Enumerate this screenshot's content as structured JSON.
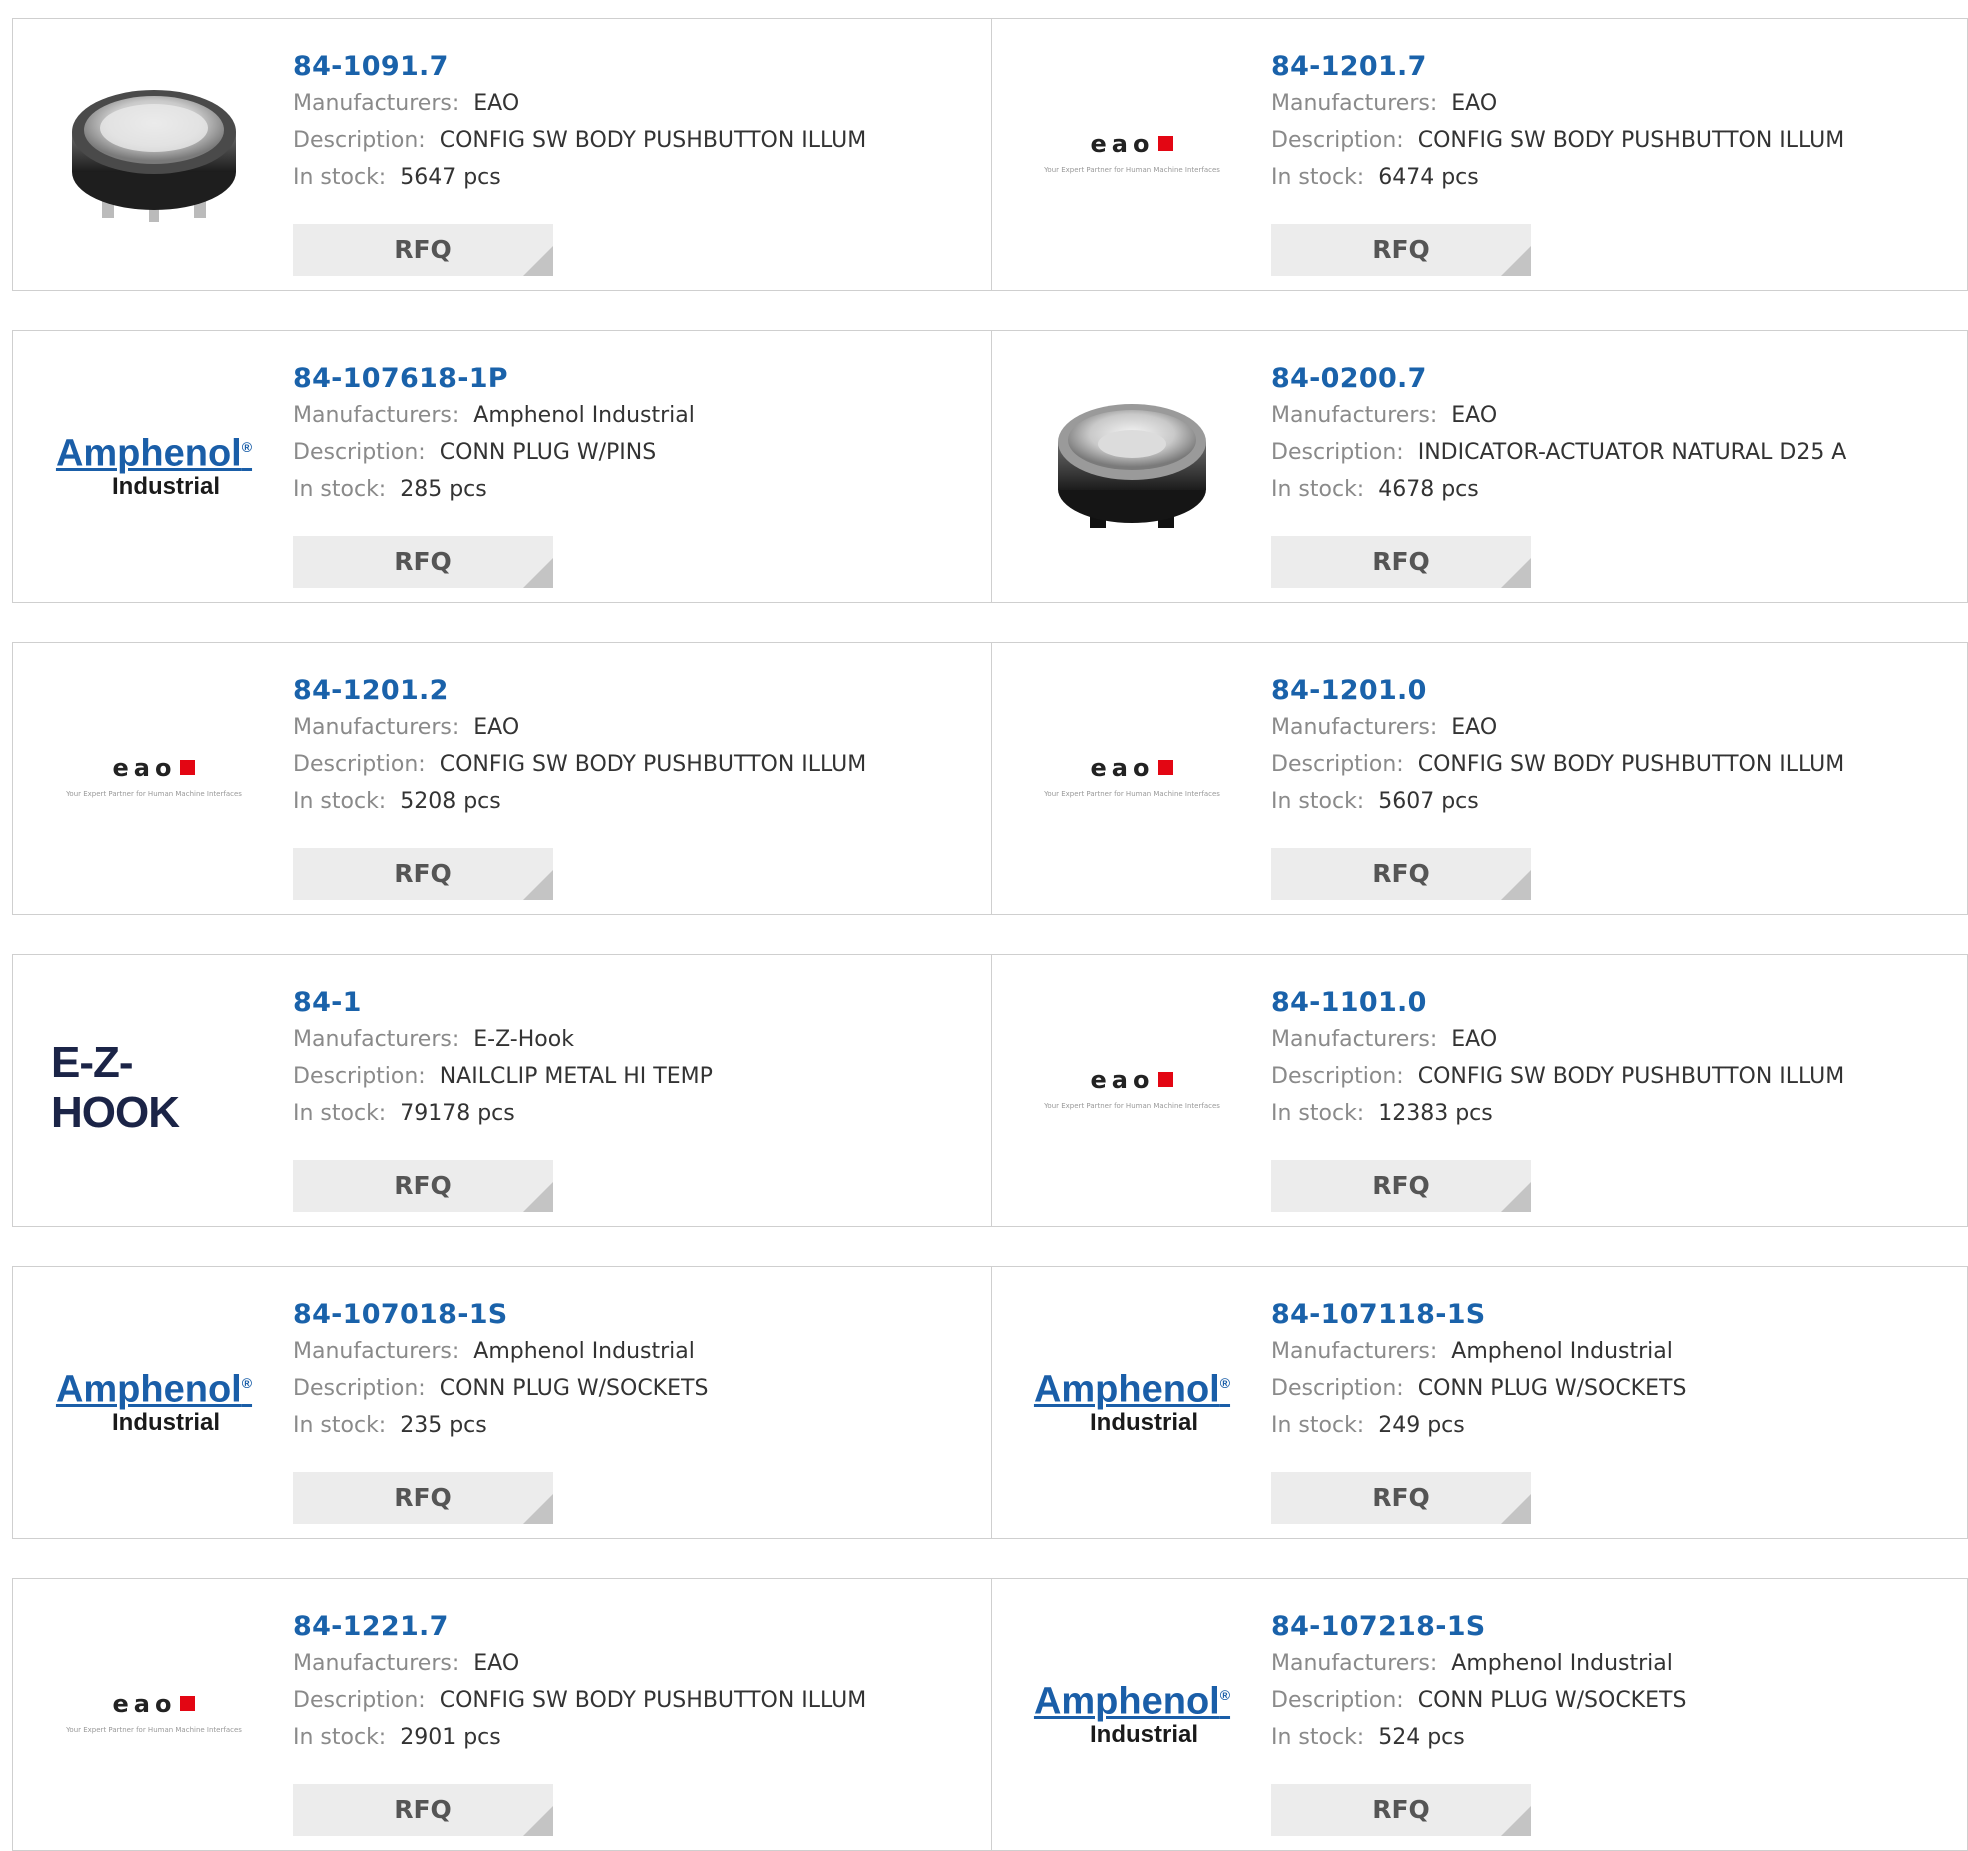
{
  "products": [
    {
      "part": "84-1091.7",
      "manufacturer": "EAO",
      "description": "CONFIG SW BODY PUSHBUTTON ILLUM",
      "stock": "5647 pcs",
      "image": "switch-body-photo"
    },
    {
      "part": "84-1201.7",
      "manufacturer": "EAO",
      "description": "CONFIG SW BODY PUSHBUTTON ILLUM",
      "stock": "6474 pcs",
      "image": "eao-logo"
    },
    {
      "part": "84-107618-1P",
      "manufacturer": "Amphenol Industrial",
      "description": "CONN PLUG W/PINS",
      "stock": "285 pcs",
      "image": "amphenol-logo"
    },
    {
      "part": "84-0200.7",
      "manufacturer": "EAO",
      "description": "INDICATOR-ACTUATOR NATURAL D25 A",
      "stock": "4678 pcs",
      "image": "actuator-photo"
    },
    {
      "part": "84-1201.2",
      "manufacturer": "EAO",
      "description": "CONFIG SW BODY PUSHBUTTON ILLUM",
      "stock": "5208 pcs",
      "image": "eao-logo"
    },
    {
      "part": "84-1201.0",
      "manufacturer": "EAO",
      "description": "CONFIG SW BODY PUSHBUTTON ILLUM",
      "stock": "5607 pcs",
      "image": "eao-logo"
    },
    {
      "part": "84-1",
      "manufacturer": "E-Z-Hook",
      "description": "NAILCLIP METAL HI TEMP",
      "stock": "79178 pcs",
      "image": "ezhook-logo"
    },
    {
      "part": "84-1101.0",
      "manufacturer": "EAO",
      "description": "CONFIG SW BODY PUSHBUTTON ILLUM",
      "stock": "12383 pcs",
      "image": "eao-logo"
    },
    {
      "part": "84-107018-1S",
      "manufacturer": "Amphenol Industrial",
      "description": "CONN PLUG W/SOCKETS",
      "stock": "235 pcs",
      "image": "amphenol-logo"
    },
    {
      "part": "84-107118-1S",
      "manufacturer": "Amphenol Industrial",
      "description": "CONN PLUG W/SOCKETS",
      "stock": "249 pcs",
      "image": "amphenol-logo"
    },
    {
      "part": "84-1221.7",
      "manufacturer": "EAO",
      "description": "CONFIG SW BODY PUSHBUTTON ILLUM",
      "stock": "2901 pcs",
      "image": "eao-logo"
    },
    {
      "part": "84-107218-1S",
      "manufacturer": "Amphenol Industrial",
      "description": "CONN PLUG W/SOCKETS",
      "stock": "524 pcs",
      "image": "amphenol-logo"
    }
  ],
  "labels": {
    "manufacturers": "Manufacturers:",
    "description": "Description:",
    "stock": "In stock:",
    "rfq": "RFQ"
  },
  "logos": {
    "eao_word": "eao",
    "eao_tagline": "Your Expert Partner for Human Machine Interfaces",
    "amphenol_word": "Amphenol",
    "amphenol_mark": "®",
    "amphenol_sub": "Industrial",
    "ezhook_word": "E-Z-HOOK"
  },
  "colors": {
    "part_link": "#1a62aa",
    "label_gray": "#8a8a8a",
    "rfq_bg": "#ececec",
    "border": "#cfcfcf",
    "eao_red": "#e30613",
    "amphenol_blue": "#1a5ea8"
  }
}
